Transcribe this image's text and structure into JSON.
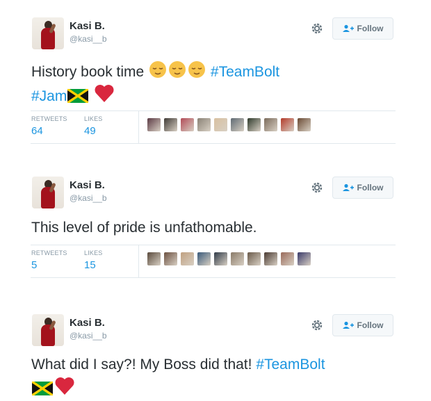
{
  "tweets": [
    {
      "user": {
        "name": "Kasi B.",
        "handle": "@kasi__b"
      },
      "follow_label": "Follow",
      "text_parts": [
        "History book time",
        "#TeamBolt",
        "#Jam"
      ],
      "stats": {
        "retweets_label": "RETWEETS",
        "retweets": "64",
        "likes_label": "LIKES",
        "likes": "49"
      },
      "liker_colors": [
        "#5b3a44",
        "#3f3a36",
        "#b24b57",
        "#8a8276",
        "#d8c0a0",
        "#5f6a73",
        "#2e3a2c",
        "#7a6a5a",
        "#b33a2a",
        "#6a4a34"
      ]
    },
    {
      "user": {
        "name": "Kasi B.",
        "handle": "@kasi__b"
      },
      "follow_label": "Follow",
      "text_parts": [
        "This level of pride is unfathomable."
      ],
      "stats": {
        "retweets_label": "RETWEETS",
        "retweets": "5",
        "likes_label": "LIKES",
        "likes": "15"
      },
      "liker_colors": [
        "#5a4a3c",
        "#6b5040",
        "#c0a080",
        "#3a5a7a",
        "#2f3a48",
        "#8a7a68",
        "#6a5a4a",
        "#4a3a32",
        "#9a6a5a",
        "#3a3a6a"
      ]
    },
    {
      "user": {
        "name": "Kasi B.",
        "handle": "@kasi__b"
      },
      "follow_label": "Follow",
      "text_parts": [
        "What did I say?! My Boss did that!",
        "#TeamBolt"
      ]
    }
  ],
  "icons": {
    "settings": "gear-icon",
    "follow": "add-user-icon",
    "emoji_relieved": "relieved-face-icon",
    "flag": "jamaica-flag-icon",
    "heart": "red-heart-icon"
  },
  "colors": {
    "link": "#1b95e0",
    "text": "#292f33",
    "muted": "#8899a6",
    "border": "#e1e8ed",
    "heart": "#d9273e"
  }
}
